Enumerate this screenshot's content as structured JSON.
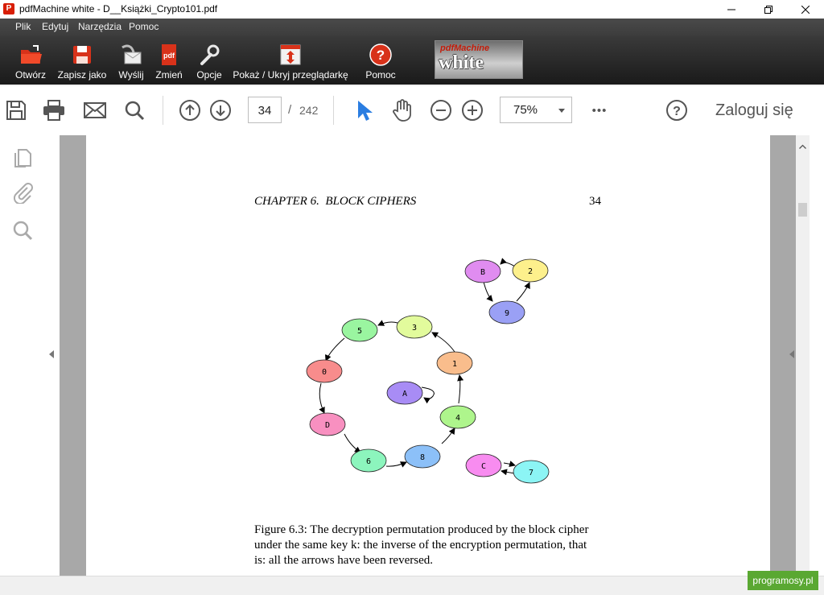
{
  "window": {
    "title": "pdfMachine white - D__Książki_Crypto101.pdf",
    "app_icon_letter": "P"
  },
  "menu": [
    "Plik",
    "Edytuj",
    "Narzędzia",
    "Pomoc"
  ],
  "toolbar": {
    "buttons": [
      {
        "label": "Otwórz",
        "icon": "open-folder-icon"
      },
      {
        "label": "Zapisz jako",
        "icon": "save-disk-icon"
      },
      {
        "label": "Wyślij",
        "icon": "send-mail-icon"
      },
      {
        "label": "Zmień",
        "icon": "pdf-edit-icon"
      },
      {
        "label": "Opcje",
        "icon": "wrench-icon"
      },
      {
        "label": "Pokaż / Ukryj przeglądarkę",
        "icon": "toggle-viewer-icon"
      },
      {
        "label": "Pomoc",
        "icon": "help-icon"
      }
    ],
    "brand_top": "pdfMachine",
    "brand_main": "white"
  },
  "viewer": {
    "current_page": "34",
    "page_separator": "/",
    "total_pages": "242",
    "zoom": "75%",
    "more": "•••",
    "login": "Zaloguj się"
  },
  "document": {
    "chapter_header": "CHAPTER 6.  BLOCK CIPHERS",
    "page_number": "34",
    "caption_lines": [
      "Figure 6.3: The decryption permutation produced by the block cipher",
      "under the same key k: the inverse of the encryption permutation, that",
      "is: all the arrows have been reversed."
    ],
    "graph_nodes": [
      {
        "label": "B",
        "color": "#e08cf0"
      },
      {
        "label": "2",
        "color": "#fdf08c"
      },
      {
        "label": "9",
        "color": "#9aa0f5"
      },
      {
        "label": "5",
        "color": "#9af5a0"
      },
      {
        "label": "3",
        "color": "#e2fb9c"
      },
      {
        "label": "1",
        "color": "#f9bd8c"
      },
      {
        "label": "0",
        "color": "#f88c8c"
      },
      {
        "label": "A",
        "color": "#a88cf5"
      },
      {
        "label": "4",
        "color": "#aef58c"
      },
      {
        "label": "D",
        "color": "#f890c0"
      },
      {
        "label": "6",
        "color": "#8cf5bd"
      },
      {
        "label": "8",
        "color": "#8cc0f8"
      },
      {
        "label": "C",
        "color": "#f88cf0"
      },
      {
        "label": "7",
        "color": "#8cf5f5"
      }
    ]
  },
  "watermark": "programosy.pl"
}
